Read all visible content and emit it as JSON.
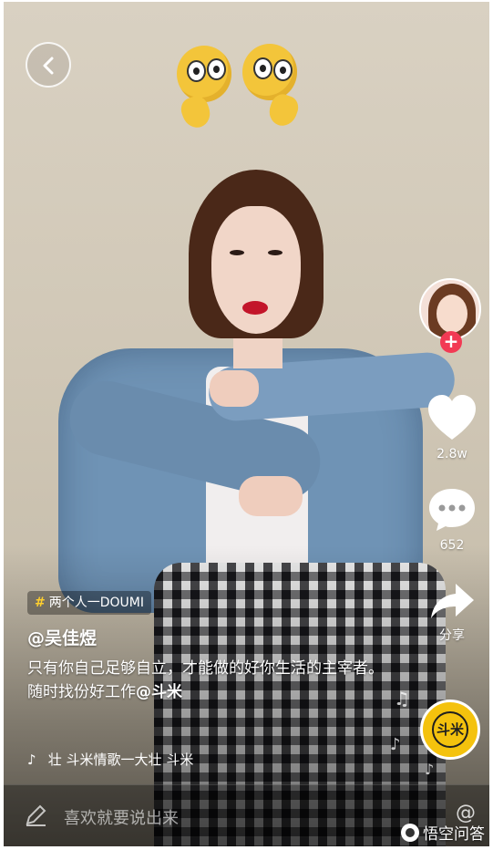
{
  "video": {
    "hashtag": "两个人一DOUMI",
    "author": "@吴佳煜",
    "caption_plain": "只有你自己足够自立，才能做的好你生活的主宰者。随时找份好工作",
    "caption_mention": "@斗米",
    "music_text": "壮  斗米情歌一大壮  斗米"
  },
  "sidebar": {
    "like_count": "2.8w",
    "comment_count": "652",
    "share_label": "分享",
    "follow_symbol": "+"
  },
  "music_disc": {
    "text": "斗米"
  },
  "comment_bar": {
    "placeholder": "喜欢就要说出来",
    "at_symbol": "@"
  },
  "watermark": {
    "text": "悟空问答"
  },
  "colors": {
    "follow_red": "#f23a54",
    "hashtag_yellow": "#ffcf2e",
    "disc_yellow": "#f4c20d"
  },
  "icons": [
    "back-arrow-icon",
    "heart-icon",
    "comment-icon",
    "share-arrow-icon",
    "music-note-icon",
    "pen-icon",
    "at-icon",
    "watermark-logo-icon"
  ]
}
